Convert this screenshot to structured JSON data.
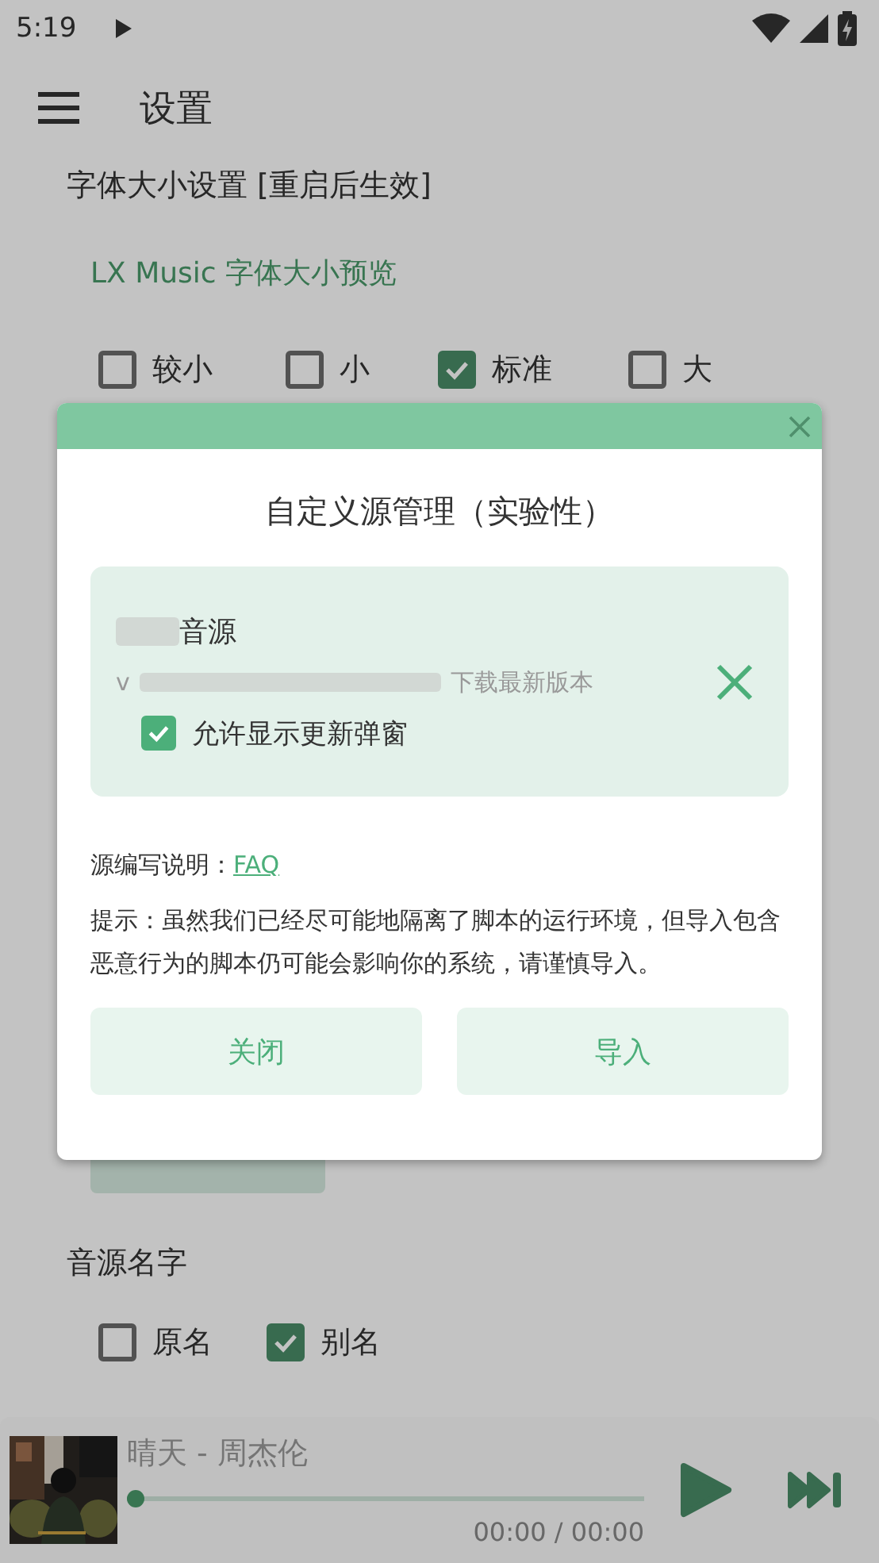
{
  "status_bar": {
    "time": "5:19"
  },
  "header": {
    "title": "设置"
  },
  "font_size": {
    "heading": "字体大小设置 [重启后生效]",
    "preview": "LX Music 字体大小预览",
    "options": [
      {
        "label": "较小",
        "selected": false
      },
      {
        "label": "小",
        "selected": false
      },
      {
        "label": "标准",
        "selected": true
      },
      {
        "label": "大",
        "selected": false
      }
    ]
  },
  "source_name": {
    "heading": "音源名字",
    "options": [
      {
        "label": "原名",
        "selected": false
      },
      {
        "label": "别名",
        "selected": true
      }
    ]
  },
  "player": {
    "track": "晴天 - 周杰伦",
    "time": "00:00 / 00:00",
    "level": 0
  },
  "dialog": {
    "title": "自定义源管理（实验性）",
    "sources": [
      {
        "name": "音源",
        "description_start": "v",
        "description_end": "下载最新版本",
        "allow_update_popup": {
          "label": "允许显示更新弹窗",
          "checked": true
        }
      }
    ],
    "guide_label": "源编写说明：",
    "guide_link": "FAQ",
    "tip": "提示：虽然我们已经尽可能地隔离了脚本的运行环境，但导入包含恶意行为的脚本仍可能会影响你的系统，请谨慎导入。",
    "buttons": [
      "关闭",
      "导入"
    ]
  }
}
